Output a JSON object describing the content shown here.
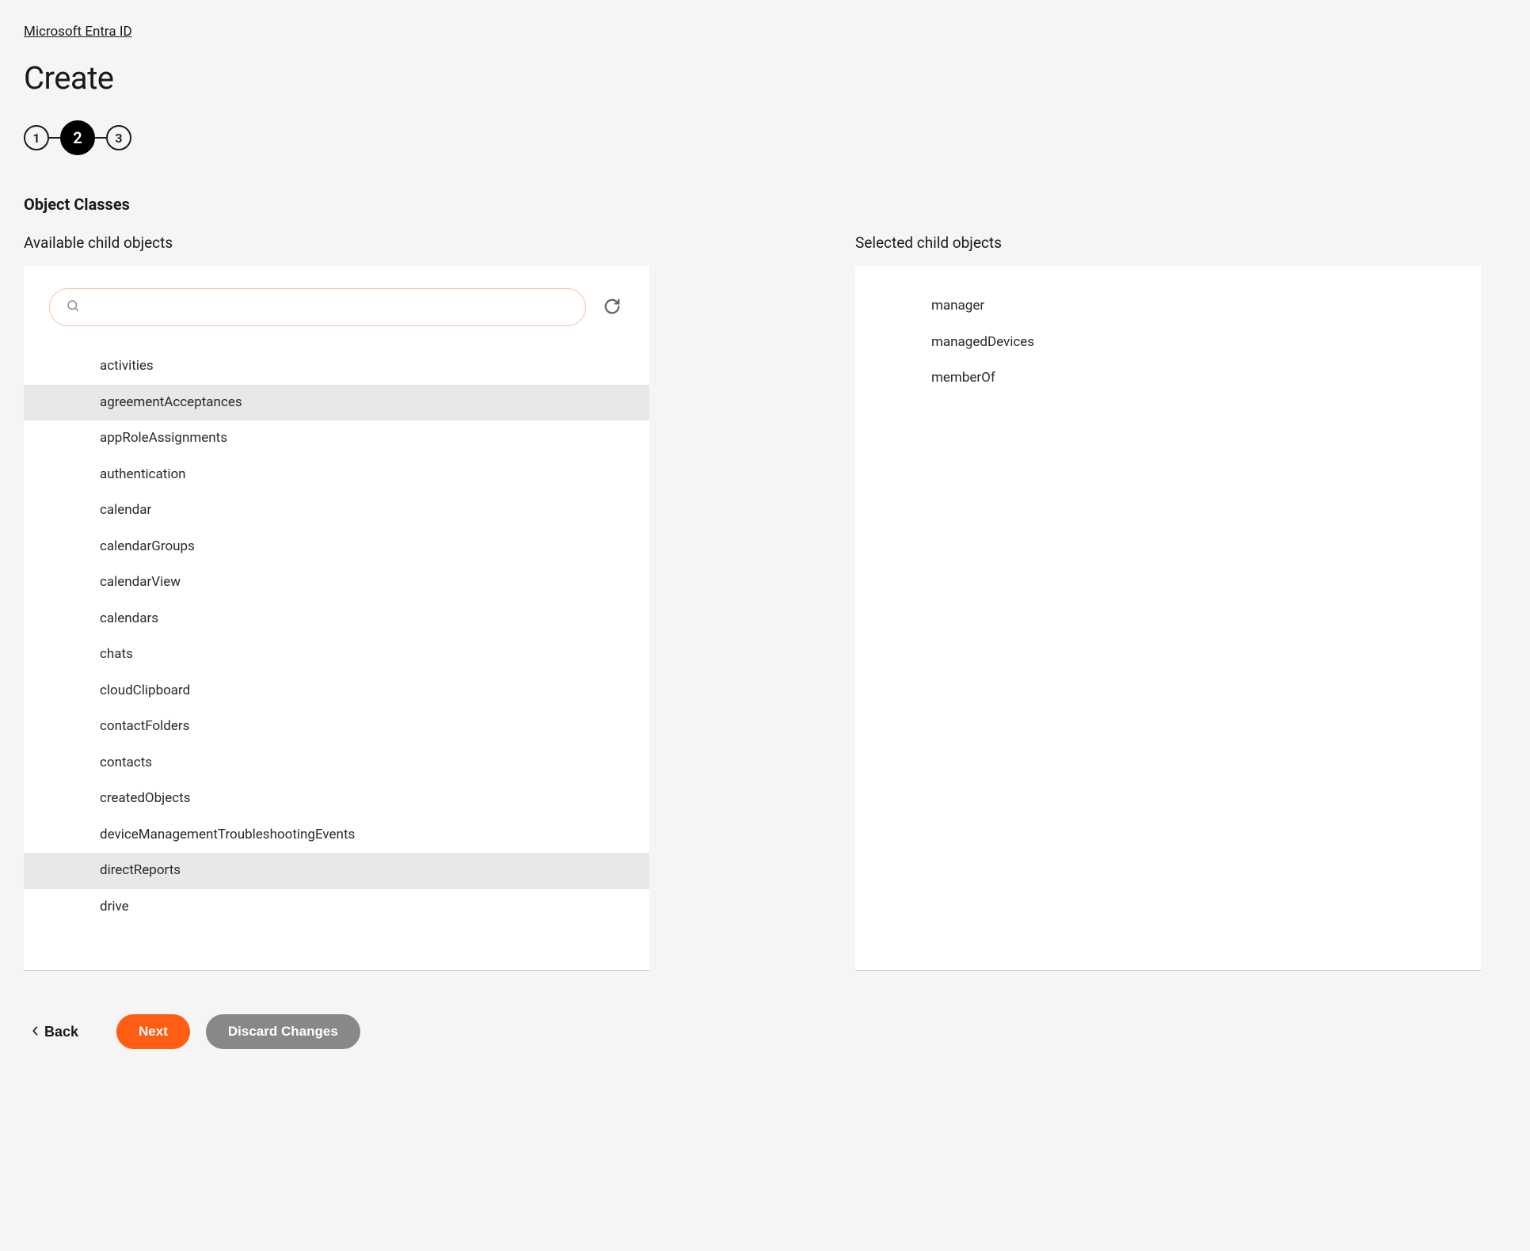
{
  "breadcrumb": {
    "label": "Microsoft Entra ID"
  },
  "page": {
    "title": "Create"
  },
  "stepper": {
    "steps": [
      "1",
      "2",
      "3"
    ],
    "activeIndex": 1
  },
  "section": {
    "title": "Object Classes"
  },
  "available": {
    "label": "Available child objects",
    "searchValue": "",
    "items": [
      {
        "label": "activities",
        "highlighted": false
      },
      {
        "label": "agreementAcceptances",
        "highlighted": true
      },
      {
        "label": "appRoleAssignments",
        "highlighted": false
      },
      {
        "label": "authentication",
        "highlighted": false
      },
      {
        "label": "calendar",
        "highlighted": false
      },
      {
        "label": "calendarGroups",
        "highlighted": false
      },
      {
        "label": "calendarView",
        "highlighted": false
      },
      {
        "label": "calendars",
        "highlighted": false
      },
      {
        "label": "chats",
        "highlighted": false
      },
      {
        "label": "cloudClipboard",
        "highlighted": false
      },
      {
        "label": "contactFolders",
        "highlighted": false
      },
      {
        "label": "contacts",
        "highlighted": false
      },
      {
        "label": "createdObjects",
        "highlighted": false
      },
      {
        "label": "deviceManagementTroubleshootingEvents",
        "highlighted": false
      },
      {
        "label": "directReports",
        "highlighted": true
      },
      {
        "label": "drive",
        "highlighted": false
      }
    ]
  },
  "selected": {
    "label": "Selected child objects",
    "items": [
      {
        "label": "manager"
      },
      {
        "label": "managedDevices"
      },
      {
        "label": "memberOf"
      }
    ]
  },
  "footer": {
    "back": "Back",
    "next": "Next",
    "discard": "Discard Changes"
  }
}
